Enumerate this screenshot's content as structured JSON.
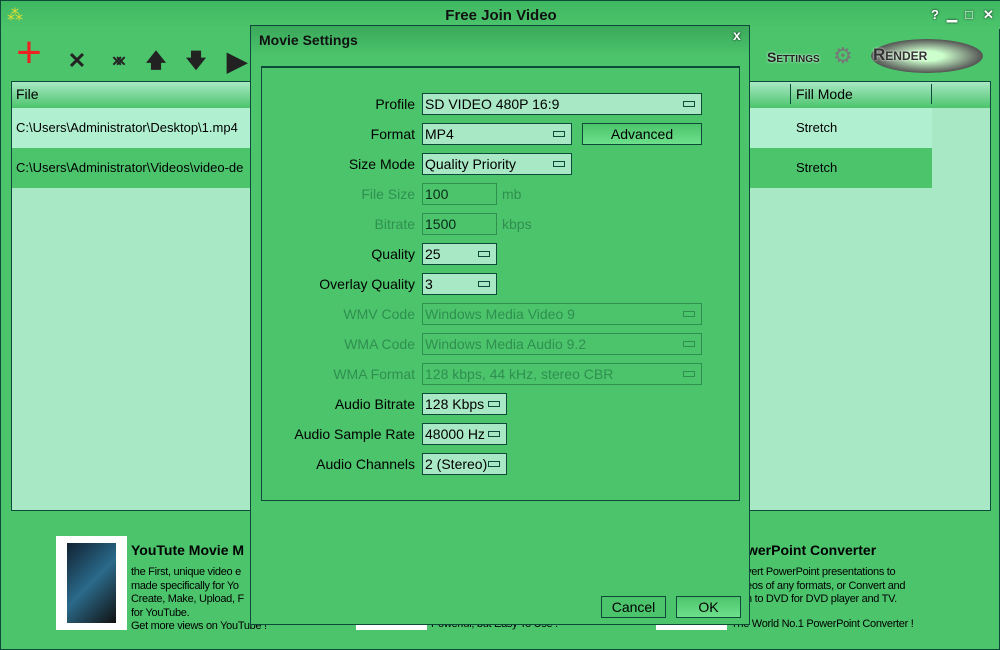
{
  "window": {
    "title": "Free Join Video",
    "help": "?",
    "minimize": "▁",
    "maximize": "□",
    "close": "✕"
  },
  "toolbar": {
    "add": "+",
    "remove": "✕",
    "remove_all": "✕✕",
    "up": "🡅",
    "down": "🡇",
    "play": "▶",
    "settings_label": "Settings",
    "render_label": "Render"
  },
  "table": {
    "columns": [
      "File",
      "Fill Mode"
    ],
    "rows": [
      {
        "file": "C:\\Users\\Administrator\\Desktop\\1.mp4",
        "fill": "Stretch"
      },
      {
        "file": "C:\\Users\\Administrator\\Videos\\video-de",
        "fill": "Stretch"
      }
    ]
  },
  "ads": [
    {
      "title": "YouTute Movie M",
      "lines": [
        "the First, unique video e",
        "made specifically for Yo",
        "Create, Make, Upload, F",
        "for YouTube.",
        "Get more views on YouTube !"
      ]
    },
    {
      "lines": [
        "Powerful, but Easy To Use !"
      ]
    },
    {
      "title": "werPoint Converter",
      "lines": [
        "vert PowerPoint presentations to",
        "eos of any formats, or Convert and",
        "n to DVD for DVD player and TV.",
        "The World No.1 PowerPoint Converter !"
      ]
    }
  ],
  "dialog": {
    "title": "Movie Settings",
    "close": "x",
    "profile_label": "Profile",
    "profile": "SD VIDEO 480P 16:9",
    "format_label": "Format",
    "format": "MP4",
    "advanced": "Advanced",
    "size_mode_label": "Size Mode",
    "size_mode": "Quality Priority",
    "file_size_label": "File Size",
    "file_size": "100",
    "file_size_unit": "mb",
    "bitrate_label": "Bitrate",
    "bitrate": "1500",
    "bitrate_unit": "kbps",
    "quality_label": "Quality",
    "quality": "25",
    "overlay_label": "Overlay Quality",
    "overlay": "3",
    "wmv_label": "WMV Code",
    "wmv": "Windows Media Video 9",
    "wma_label": "WMA Code",
    "wma": "Windows Media Audio 9.2",
    "wma_format_label": "WMA Format",
    "wma_format": "128 kbps, 44 kHz, stereo CBR",
    "audio_bitrate_label": "Audio Bitrate",
    "audio_bitrate": "128 Kbps",
    "sample_rate_label": "Audio Sample Rate",
    "sample_rate": "48000 Hz",
    "channels_label": "Audio Channels",
    "channels": "2 (Stereo)",
    "cancel": "Cancel",
    "ok": "OK"
  },
  "colors": {
    "background": "#4cc46c",
    "list": "#a8e8c4",
    "row_selected": "#b0f0d0",
    "border": "#0d4a3a",
    "add_icon": "#ee2222"
  }
}
